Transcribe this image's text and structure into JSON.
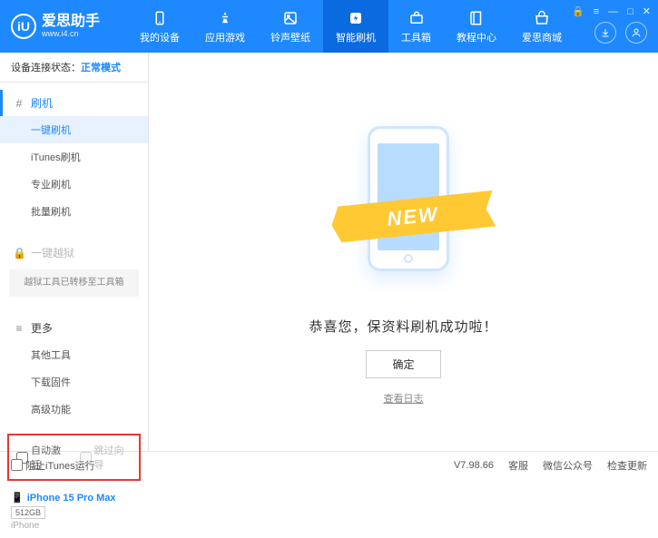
{
  "header": {
    "logo_mark": "iU",
    "logo_title": "爱思助手",
    "logo_url": "www.i4.cn",
    "nav": [
      {
        "label": "我的设备"
      },
      {
        "label": "应用游戏"
      },
      {
        "label": "铃声壁纸"
      },
      {
        "label": "智能刷机"
      },
      {
        "label": "工具箱"
      },
      {
        "label": "教程中心"
      },
      {
        "label": "爱思商城"
      }
    ]
  },
  "status": {
    "label": "设备连接状态：",
    "value": "正常模式"
  },
  "sidebar": {
    "flash_header": "刷机",
    "flash_items": [
      "一键刷机",
      "iTunes刷机",
      "专业刷机",
      "批量刷机"
    ],
    "jailbreak_header": "一键越狱",
    "jailbreak_note": "越狱工具已转移至工具箱",
    "more_header": "更多",
    "more_items": [
      "其他工具",
      "下载固件",
      "高级功能"
    ],
    "checkbox_auto": "自动激活",
    "checkbox_skip": "跳过向导"
  },
  "device": {
    "name": "iPhone 15 Pro Max",
    "storage": "512GB",
    "type": "iPhone"
  },
  "main": {
    "ribbon": "NEW",
    "message": "恭喜您，保资料刷机成功啦！",
    "ok_button": "确定",
    "log_link": "查看日志"
  },
  "footer": {
    "block_itunes": "阻止iTunes运行",
    "version": "V7.98.66",
    "links": [
      "客服",
      "微信公众号",
      "检查更新"
    ]
  }
}
